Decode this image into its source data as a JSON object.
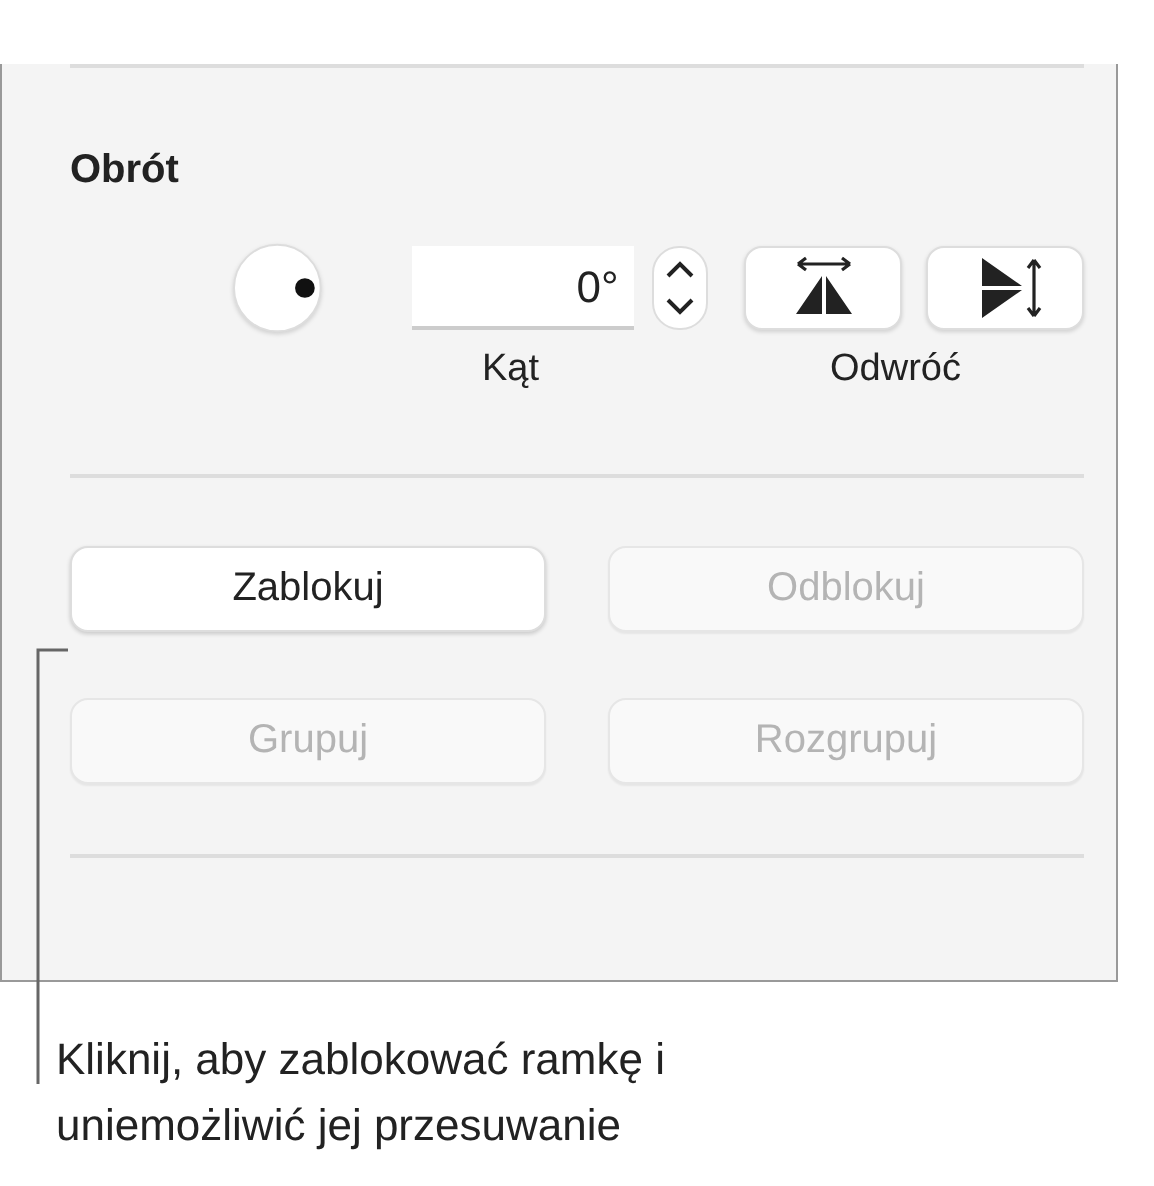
{
  "rotation": {
    "title": "Obrót",
    "angle_value": "0°",
    "angle_label": "Kąt",
    "flip_label": "Odwróć"
  },
  "buttons": [
    {
      "label": "Zablokuj",
      "disabled": false
    },
    {
      "label": "Odblokuj",
      "disabled": true
    },
    {
      "label": "Grupuj",
      "disabled": true
    },
    {
      "label": "Rozgrupuj",
      "disabled": true
    }
  ],
  "callout": "Kliknij, aby zablokować ramkę i uniemożliwić jej przesuwanie"
}
